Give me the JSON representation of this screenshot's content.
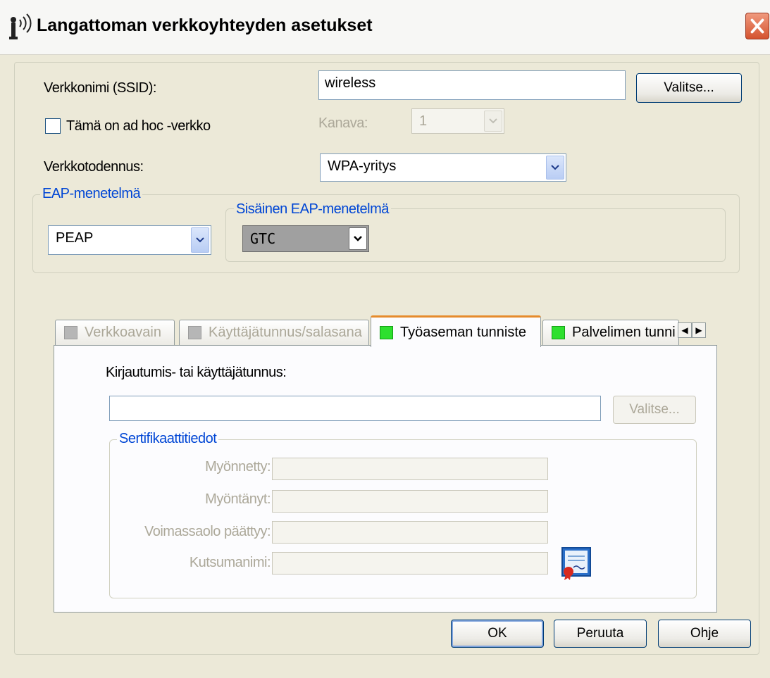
{
  "window": {
    "title": "Langattoman verkkoyhteyden asetukset"
  },
  "ssid": {
    "label": "Verkkonimi (SSID):",
    "value": "wireless",
    "choose_label": "Valitse..."
  },
  "adhoc": {
    "label": "Tämä on ad hoc -verkko",
    "checked": false
  },
  "channel": {
    "label": "Kanava:",
    "value": "1"
  },
  "auth": {
    "label": "Verkkotodennus:",
    "value": "WPA-yritys"
  },
  "eap": {
    "legend": "EAP-menetelmä",
    "value": "PEAP"
  },
  "inner_eap": {
    "legend": "Sisäinen EAP-menetelmä",
    "value": "GTC"
  },
  "tabs": [
    {
      "label": "Verkkoavain",
      "status": "gray"
    },
    {
      "label": "Käyttäjätunnus/salasana",
      "status": "gray"
    },
    {
      "label": "Työaseman tunniste",
      "status": "green",
      "active": true
    },
    {
      "label": "Palvelimen tunni",
      "status": "green"
    }
  ],
  "login": {
    "label": "Kirjautumis- tai käyttäjätunnus:",
    "value": "",
    "choose_label": "Valitse..."
  },
  "cert": {
    "legend": "Sertifikaattitiedot",
    "fields": [
      {
        "label": "Myönnetty:",
        "value": ""
      },
      {
        "label": "Myöntänyt:",
        "value": ""
      },
      {
        "label": "Voimassaolo päättyy:",
        "value": ""
      },
      {
        "label": "Kutsumanimi:",
        "value": ""
      }
    ]
  },
  "footer": {
    "ok": "OK",
    "cancel": "Peruuta",
    "help": "Ohje"
  },
  "colors": {
    "accent_tab": "#e68b2c",
    "legend_blue": "#0046d5",
    "status_green": "#2ee02e"
  }
}
